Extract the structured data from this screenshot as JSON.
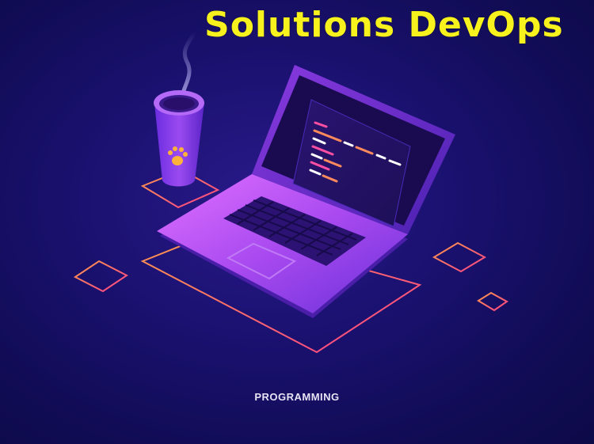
{
  "headline": "Solutions DevOps",
  "caption": "PROGRAMMING",
  "illustration": {
    "subject": "isometric laptop with code editor and coffee cup",
    "icons": [
      "laptop-icon",
      "coffee-cup-icon",
      "paw-print-icon",
      "steam-icon",
      "keyboard-icon",
      "touchpad-icon"
    ]
  },
  "colors": {
    "background": "#150f5e",
    "headline": "#f7f21e",
    "caption": "#e6e3f5",
    "accent_orange": "#ff8a5c",
    "accent_purple": "#b14cf0",
    "accent_pink": "#ff4fa3"
  }
}
